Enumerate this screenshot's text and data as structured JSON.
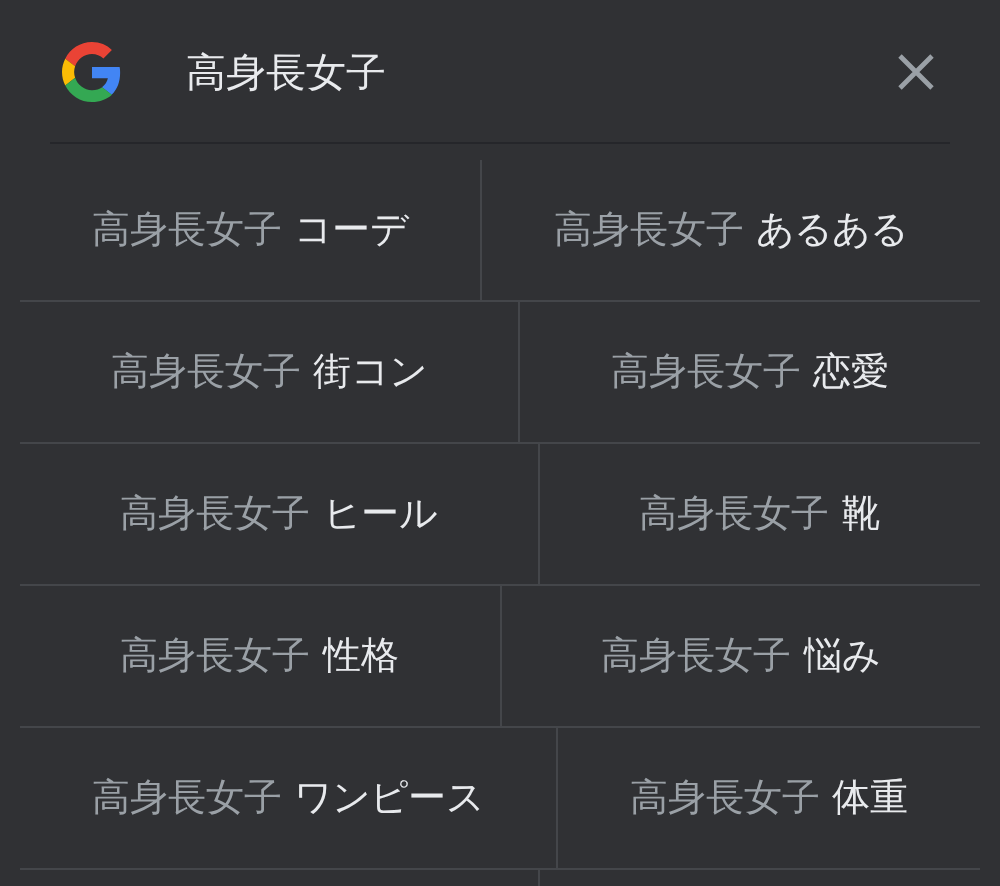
{
  "search": {
    "query": "高身長女子"
  },
  "suggestions": [
    [
      {
        "prefix": "高身長女子",
        "suffix": "コーデ"
      },
      {
        "prefix": "高身長女子",
        "suffix": "あるある"
      }
    ],
    [
      {
        "prefix": "高身長女子",
        "suffix": "街コン"
      },
      {
        "prefix": "高身長女子",
        "suffix": "恋愛"
      }
    ],
    [
      {
        "prefix": "高身長女子",
        "suffix": "ヒール"
      },
      {
        "prefix": "高身長女子",
        "suffix": "靴"
      }
    ],
    [
      {
        "prefix": "高身長女子",
        "suffix": "性格"
      },
      {
        "prefix": "高身長女子",
        "suffix": "悩み"
      }
    ],
    [
      {
        "prefix": "高身長女子",
        "suffix": "ワンピース"
      },
      {
        "prefix": "高身長女子",
        "suffix": "体重"
      }
    ]
  ]
}
